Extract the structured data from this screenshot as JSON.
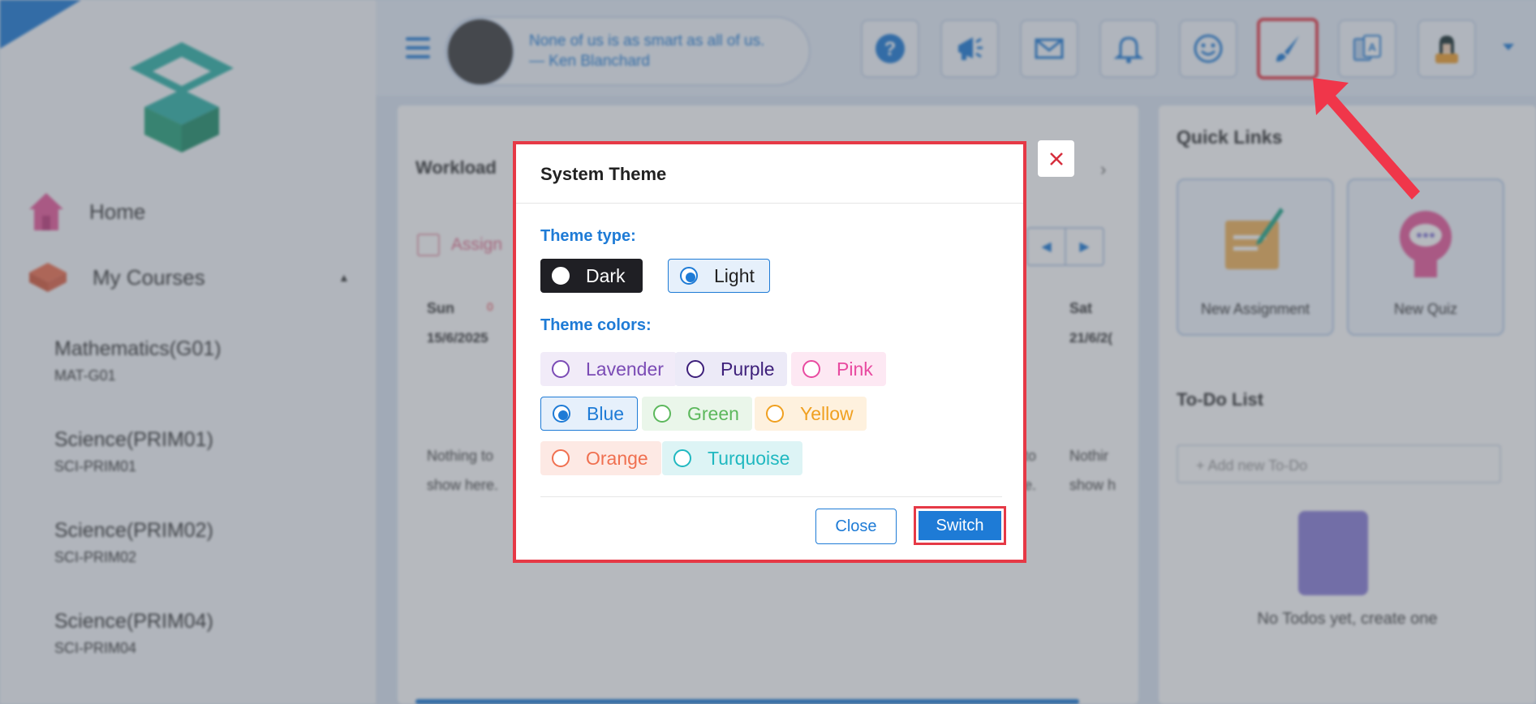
{
  "sidebar": {
    "home": "Home",
    "my_courses": "My Courses",
    "courses": [
      {
        "name": "Mathematics(G01)",
        "code": "MAT-G01"
      },
      {
        "name": "Science(PRIM01)",
        "code": "SCI-PRIM01"
      },
      {
        "name": "Science(PRIM02)",
        "code": "SCI-PRIM02"
      },
      {
        "name": "Science(PRIM04)",
        "code": "SCI-PRIM04"
      }
    ]
  },
  "header": {
    "quote": "None of us is as smart as all of us. — Ken Blanchard",
    "icons": [
      "help-icon",
      "announcement-icon",
      "mail-icon",
      "bell-icon",
      "smiley-icon",
      "paintbrush-icon",
      "translate-icon",
      "user-avatar"
    ],
    "active_icon": "paintbrush-icon"
  },
  "workload": {
    "title": "Workload",
    "assign_label": "Assign",
    "days": [
      {
        "day": "Sun",
        "date": "15/6/2025",
        "count": "0"
      },
      {
        "day": "Sat",
        "date": "21/6/2("
      }
    ],
    "empty_text_1": "Nothing to",
    "empty_text_2": "show here.",
    "empty_text_3": "Nothir",
    "empty_text_4": "show h",
    "partial_right_1": "to",
    "partial_right_2": "e."
  },
  "quick_links": {
    "title": "Quick Links",
    "items": [
      {
        "label": "New Assignment"
      },
      {
        "label": "New Quiz"
      }
    ]
  },
  "todo": {
    "title": "To-Do List",
    "placeholder": "+ Add new To-Do",
    "empty": "No Todos yet, create one"
  },
  "modal": {
    "title": "System Theme",
    "theme_type_label": "Theme type:",
    "theme_types": [
      {
        "label": "Dark",
        "selected": false
      },
      {
        "label": "Light",
        "selected": true
      }
    ],
    "theme_colors_label": "Theme colors:",
    "colors": [
      {
        "label": "Lavender",
        "color": "#7b4bb5",
        "bg": "#f1ebf8",
        "selected": false
      },
      {
        "label": "Purple",
        "color": "#3d1f7a",
        "bg": "#eceaf7",
        "selected": false
      },
      {
        "label": "Pink",
        "color": "#e84aa0",
        "bg": "#fde8f3",
        "selected": false
      },
      {
        "label": "Blue",
        "color": "#1e7bd6",
        "bg": "#e6f0fb",
        "selected": true
      },
      {
        "label": "Green",
        "color": "#5cb85c",
        "bg": "#eaf6ea",
        "selected": false
      },
      {
        "label": "Yellow",
        "color": "#f0a020",
        "bg": "#fef1de",
        "selected": false
      },
      {
        "label": "Orange",
        "color": "#f07050",
        "bg": "#fde9e4",
        "selected": false
      },
      {
        "label": "Turquoise",
        "color": "#20b8c0",
        "bg": "#ddf4f5",
        "selected": false
      }
    ],
    "close_button": "Close",
    "switch_button": "Switch"
  }
}
